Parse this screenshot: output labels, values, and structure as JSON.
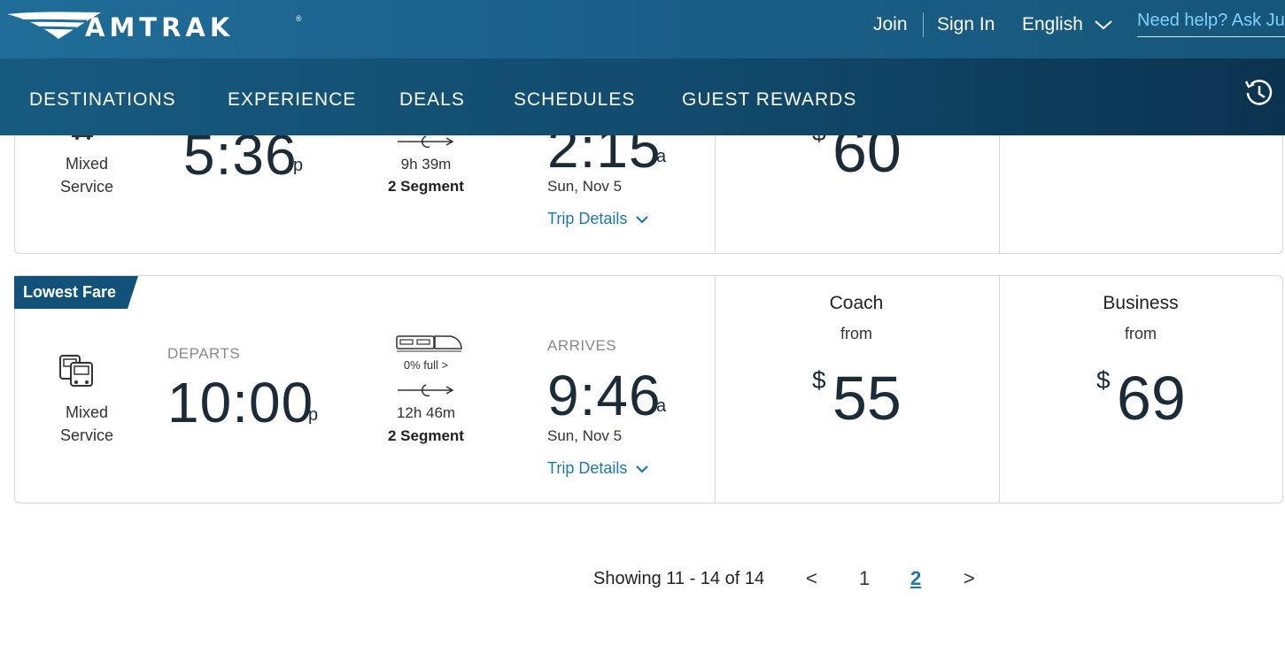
{
  "brand": {
    "name": "AMTRAK",
    "reg": "®"
  },
  "header": {
    "join": "Join",
    "sign_in": "Sign In",
    "language": "English",
    "help": "Need help? Ask Ju"
  },
  "nav": [
    "DESTINATIONS",
    "EXPERIENCE",
    "DEALS",
    "SCHEDULES",
    "GUEST REWARDS"
  ],
  "results": [
    {
      "service": [
        "Mixed",
        "Service"
      ],
      "depart_time": "5:36",
      "depart_ampm": "p",
      "duration": "9h 39m",
      "segments": "2 Segment",
      "arrive_time": "2:15",
      "arrive_ampm": "a",
      "arrive_date": "Sun, Nov 5",
      "trip_details": "Trip Details",
      "coach_currency": "$",
      "coach_price": "60"
    },
    {
      "badge": "Lowest Fare",
      "service": [
        "Mixed",
        "Service"
      ],
      "departs_label": "DEPARTS",
      "depart_time": "10:00",
      "depart_ampm": "p",
      "occupancy": "0% full >",
      "duration": "12h 46m",
      "segments": "2 Segment",
      "arrives_label": "ARRIVES",
      "arrive_time": "9:46",
      "arrive_ampm": "a",
      "arrive_date": "Sun, Nov 5",
      "trip_details": "Trip Details",
      "coach_label": "Coach",
      "coach_from": "from",
      "coach_currency": "$",
      "coach_price": "55",
      "business_label": "Business",
      "business_from": "from",
      "business_currency": "$",
      "business_price": "69"
    }
  ],
  "pagination": {
    "summary": "Showing 11 - 14 of 14",
    "prev": "<",
    "pages": [
      "1",
      "2"
    ],
    "active_page": "2",
    "next": ">"
  },
  "colors": {
    "header": "#1f6d98",
    "nav": "#114a6c",
    "link": "#1f79a6",
    "badge": "#12527a"
  }
}
